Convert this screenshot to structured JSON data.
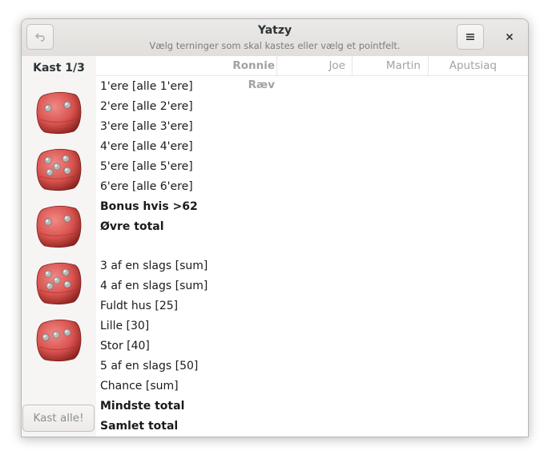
{
  "window": {
    "title": "Yatzy",
    "subtitle": "Vælg terninger som skal kastes eller vælg et pointfelt."
  },
  "header_icons": {
    "undo": "undo-arrow-icon",
    "menu": "hamburger-menu-icon",
    "close": "close-icon"
  },
  "sidebar": {
    "roll_label": "Kast 1/3",
    "dice": [
      {
        "value": 2,
        "icon": "die-2-icon"
      },
      {
        "value": 5,
        "icon": "die-5-icon"
      },
      {
        "value": 2,
        "icon": "die-2-icon"
      },
      {
        "value": 5,
        "icon": "die-5-icon"
      },
      {
        "value": 3,
        "icon": "die-3-icon"
      }
    ],
    "roll_button": "Kast alle!"
  },
  "players": [
    "Ronnie Ræv",
    "Joe",
    "Martin",
    "Aputsiaq"
  ],
  "categories": [
    {
      "label": "1'ere [alle 1'ere]",
      "bold": false
    },
    {
      "label": "2'ere [alle 2'ere]",
      "bold": false
    },
    {
      "label": "3'ere [alle 3'ere]",
      "bold": false
    },
    {
      "label": "4'ere [alle 4'ere]",
      "bold": false
    },
    {
      "label": "5'ere [alle 5'ere]",
      "bold": false
    },
    {
      "label": "6'ere [alle 6'ere]",
      "bold": false
    },
    {
      "label": "Bonus hvis >62",
      "bold": true
    },
    {
      "label": "Øvre total",
      "bold": true
    },
    {
      "label": "3 af en slags [sum]",
      "bold": false
    },
    {
      "label": "4 af en slags [sum]",
      "bold": false
    },
    {
      "label": "Fuldt hus [25]",
      "bold": false
    },
    {
      "label": "Lille [30]",
      "bold": false
    },
    {
      "label": "Stor [40]",
      "bold": false
    },
    {
      "label": "5 af en slags [50]",
      "bold": false
    },
    {
      "label": "Chance [sum]",
      "bold": false
    },
    {
      "label": "Mindste total",
      "bold": true
    },
    {
      "label": "Samlet total",
      "bold": true
    }
  ],
  "colors": {
    "die_red": "#d9534f",
    "die_pip": "#b8b8b8"
  }
}
